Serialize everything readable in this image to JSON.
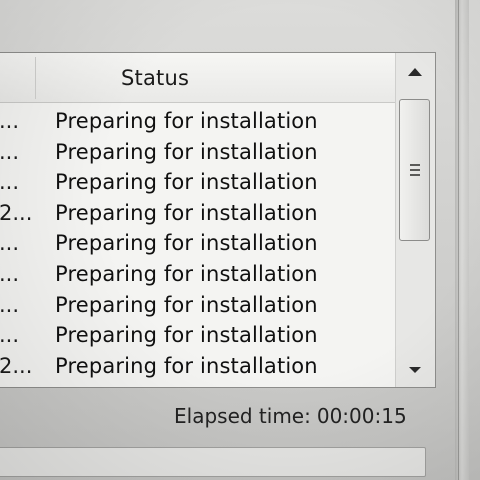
{
  "list": {
    "columns": {
      "status_header": "Status"
    },
    "rows": [
      {
        "prev": "...",
        "status": "Preparing for installation"
      },
      {
        "prev": "...",
        "status": "Preparing for installation"
      },
      {
        "prev": "...",
        "status": "Preparing for installation"
      },
      {
        "prev": "2...",
        "status": "Preparing for installation"
      },
      {
        "prev": "...",
        "status": "Preparing for installation"
      },
      {
        "prev": "...",
        "status": "Preparing for installation"
      },
      {
        "prev": "...",
        "status": "Preparing for installation"
      },
      {
        "prev": "...",
        "status": "Preparing for installation"
      },
      {
        "prev": "2...",
        "status": "Preparing for installation"
      }
    ]
  },
  "scrollbar": {
    "up_icon": "scroll-up-arrow",
    "down_icon": "scroll-down-arrow",
    "grip_icon": "grip-lines"
  },
  "footer": {
    "elapsed_label": "Elapsed time:",
    "elapsed_value": "00:00:15"
  },
  "progress": {
    "fraction": 0,
    "fill_color": "#3cb43c"
  }
}
